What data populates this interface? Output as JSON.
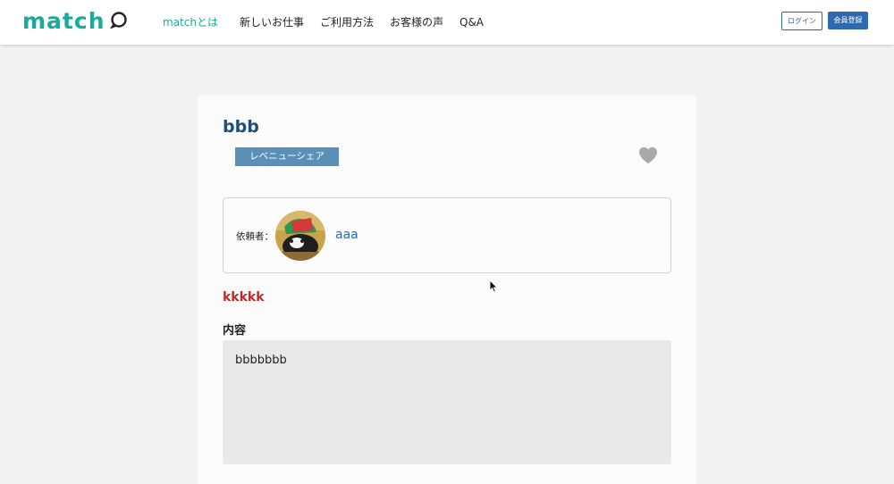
{
  "header": {
    "logo_text": "match",
    "nav": [
      {
        "label": "matchとは",
        "active": true
      },
      {
        "label": "新しいお仕事",
        "active": false
      },
      {
        "label": "ご利用方法",
        "active": false
      },
      {
        "label": "お客様の声",
        "active": false
      },
      {
        "label": "Q&A",
        "active": false
      }
    ],
    "login_label": "ログイン",
    "register_label": "会員登録"
  },
  "job": {
    "title": "bbb",
    "tag": "レベニューシェア",
    "requester_label": "依頼者：",
    "requester_name": "aaa",
    "subtitle": "kkkkk",
    "content_label": "内容",
    "content_text": "bbbbbbb"
  },
  "icons": {
    "logo": "speech-bubble-icon",
    "favorite": "heart-icon",
    "avatar": "requester-avatar",
    "cursor": "mouse-pointer-icon"
  },
  "colors": {
    "brand": "#1aab9b",
    "title": "#1c4f7c",
    "tag_bg": "#5a90b8",
    "link": "#2f6ab0",
    "subtitle": "#c22a2a",
    "heart": "#a9a9a9"
  }
}
